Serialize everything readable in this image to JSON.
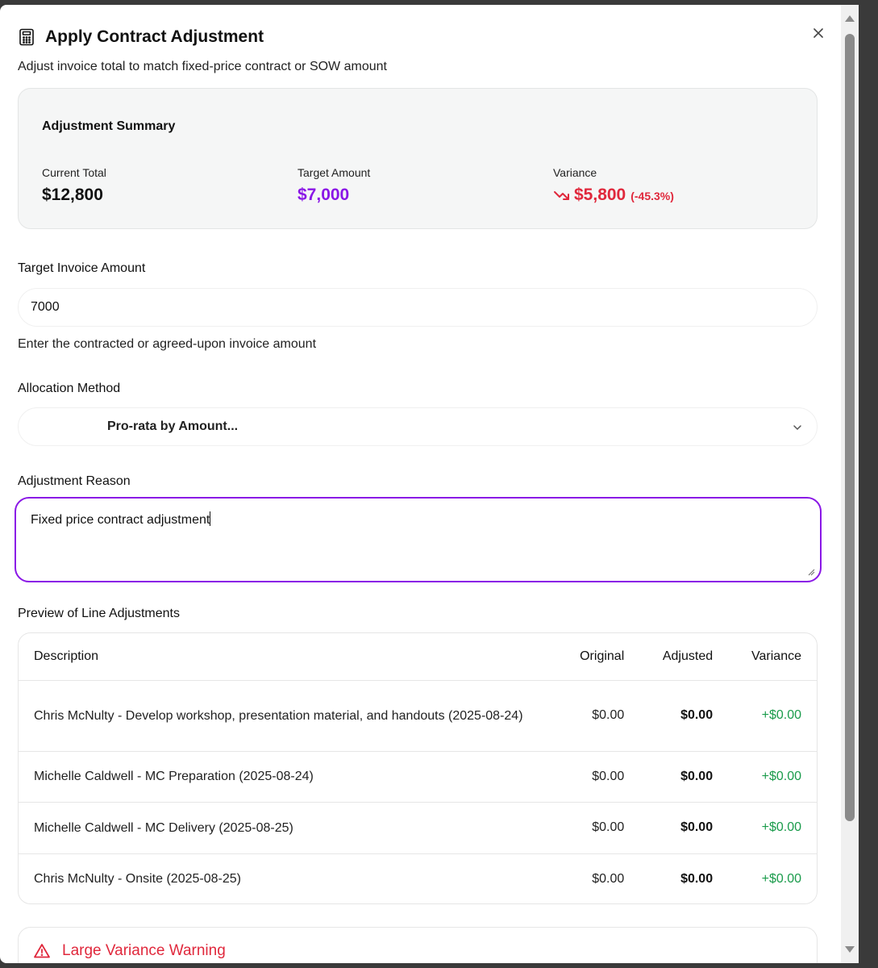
{
  "dialog": {
    "title": "Apply Contract Adjustment",
    "subtitle": "Adjust invoice total to match fixed-price contract or SOW amount",
    "title_icon": "calculator-icon",
    "close_icon": "close-icon"
  },
  "summary": {
    "heading": "Adjustment Summary",
    "current_total_label": "Current Total",
    "current_total_value": "$12,800",
    "target_amount_label": "Target Amount",
    "target_amount_value": "$7,000",
    "variance_label": "Variance",
    "variance_value": "$5,800",
    "variance_pct": "(-45.3%)",
    "variance_icon": "trending-down-icon"
  },
  "form": {
    "target_label": "Target Invoice Amount",
    "target_value": "7000",
    "target_helper": "Enter the contracted or agreed-upon invoice amount",
    "allocation_label": "Allocation Method",
    "allocation_value": "Pro-rata by Amount...",
    "reason_label": "Adjustment Reason",
    "reason_value": "Fixed price contract adjustment"
  },
  "preview": {
    "title": "Preview of Line Adjustments",
    "columns": [
      "Description",
      "Original",
      "Adjusted",
      "Variance"
    ],
    "rows": [
      {
        "description": "Chris McNulty - Develop workshop, presentation material, and handouts (2025-08-24)",
        "original": "$0.00",
        "adjusted": "$0.00",
        "variance": "+$0.00"
      },
      {
        "description": "Michelle Caldwell - MC Preparation (2025-08-24)",
        "original": "$0.00",
        "adjusted": "$0.00",
        "variance": "+$0.00"
      },
      {
        "description": "Michelle Caldwell - MC Delivery (2025-08-25)",
        "original": "$0.00",
        "adjusted": "$0.00",
        "variance": "+$0.00"
      },
      {
        "description": "Chris McNulty - Onsite (2025-08-25)",
        "original": "$0.00",
        "adjusted": "$0.00",
        "variance": "+$0.00"
      }
    ]
  },
  "warning": {
    "title": "Large Variance Warning",
    "icon": "warning-triangle-icon"
  },
  "colors": {
    "accent_purple": "#8a17e6",
    "danger_red": "#e0283c",
    "success_green": "#1a9b4b"
  }
}
